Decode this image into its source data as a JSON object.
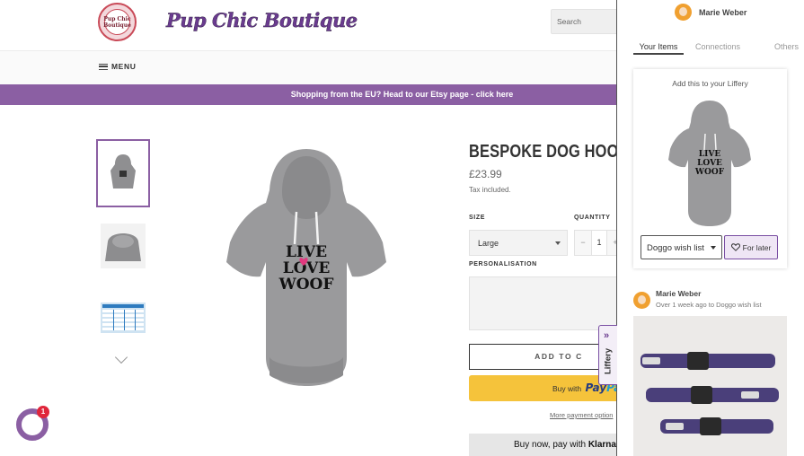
{
  "store": {
    "logo_text": "Pup Chic Boutique",
    "brand_name": "Pup Chic Boutique",
    "search_placeholder": "Search",
    "menu_label": "MENU",
    "banner_text": "Shopping from the EU? Head to our Etsy page - click here",
    "product": {
      "title": "BESPOKE DOG HOOD",
      "price": "£23.99",
      "tax_note": "Tax included.",
      "size_label": "SIZE",
      "size_value": "Large",
      "quantity_label": "QUANTITY",
      "quantity_minus": "−",
      "quantity_value": "1",
      "quantity_plus": "+",
      "personalisation_label": "PERSONALISATION",
      "add_to_cart": "ADD TO C",
      "paypal_prefix": "Buy with",
      "paypal_brand_a": "Pay",
      "paypal_brand_b": "Pa",
      "more_payment": "More payment option",
      "klarna_text": "Buy now, pay with",
      "klarna_brand": "Klarna.",
      "hoodie_print": [
        "LIVE",
        "LOVE",
        "WOOF"
      ]
    },
    "chat_badge": "1"
  },
  "liffery_tab": {
    "label": "Liffery",
    "arrow": "»"
  },
  "panel": {
    "user_name": "Marie Weber",
    "tabs": [
      "Your Items",
      "Connections",
      "Others"
    ],
    "active_tab": "Your Items",
    "card_title": "Add this to your Liffery",
    "wishlist_value": "Doggo wish list",
    "for_later_label": "For later",
    "post": {
      "user_name": "Marie Weber",
      "meta": "Over 1 week ago to Doggo wish list"
    }
  },
  "colors": {
    "accent_purple": "#8b5fa3",
    "paypal_yellow": "#f5c33b",
    "badge_red": "#e0263b"
  }
}
